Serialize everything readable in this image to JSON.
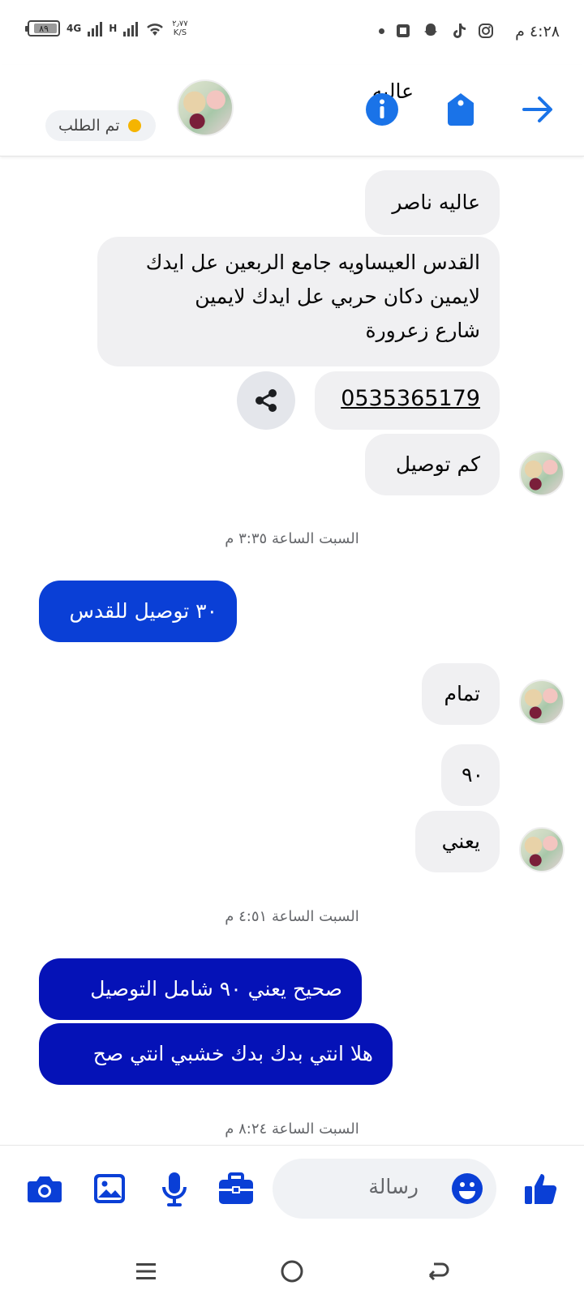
{
  "status_bar": {
    "time": "٤:٢٨ م",
    "battery": "٨٩",
    "battery_fraction": 0.89,
    "network_1": "4G",
    "network_2": "H",
    "speed_value": "٢٫٧٧",
    "speed_unit": "K/S",
    "icons": [
      "instagram-icon",
      "tiktok-icon",
      "snapchat-icon",
      "app-icon",
      "dot-icon"
    ]
  },
  "header": {
    "contact_name": "عاليه",
    "order_status": "تم الطلب",
    "status_color": "#f5b400",
    "accent": "#1a73e8",
    "icons": [
      "info-icon",
      "tag-icon",
      "forward-arrow-icon"
    ]
  },
  "messages": [
    {
      "side": "in",
      "text": "عاليه ناصر"
    },
    {
      "side": "in",
      "lines": [
        "القدس العيساويه جامع الربعين عل ايدك",
        "لايمين دكان حربي عل ايدك لايمين",
        "شارع زعرورة"
      ]
    },
    {
      "side": "in",
      "text": "0535365179",
      "link": true
    },
    {
      "side": "in",
      "text": "كم توصيل"
    },
    {
      "timestamp": "السبت الساعة ٣:٣٥ م"
    },
    {
      "side": "out",
      "text": "٣٠ توصيل للقدس"
    },
    {
      "side": "in",
      "text": "تمام"
    },
    {
      "side": "in",
      "text": "٩٠"
    },
    {
      "side": "in",
      "text": "يعني"
    },
    {
      "timestamp": "السبت الساعة ٤:٥١ م"
    },
    {
      "side": "out",
      "text": "صحيح يعني ٩٠ شامل التوصيل"
    },
    {
      "side": "out",
      "text": "هلا انتي بدك بدك خشبي انتي صح"
    },
    {
      "timestamp": "السبت الساعة ٨:٢٤ م"
    }
  ],
  "composer": {
    "placeholder": "رسالة",
    "icons": [
      "camera-icon",
      "image-icon",
      "microphone-icon",
      "briefcase-icon",
      "emoji-icon",
      "thumbs-up-icon"
    ],
    "accent": "#0a3fd6"
  },
  "nav_bar": {
    "icons": [
      "menu-icon",
      "home-circle-icon",
      "back-icon"
    ]
  }
}
